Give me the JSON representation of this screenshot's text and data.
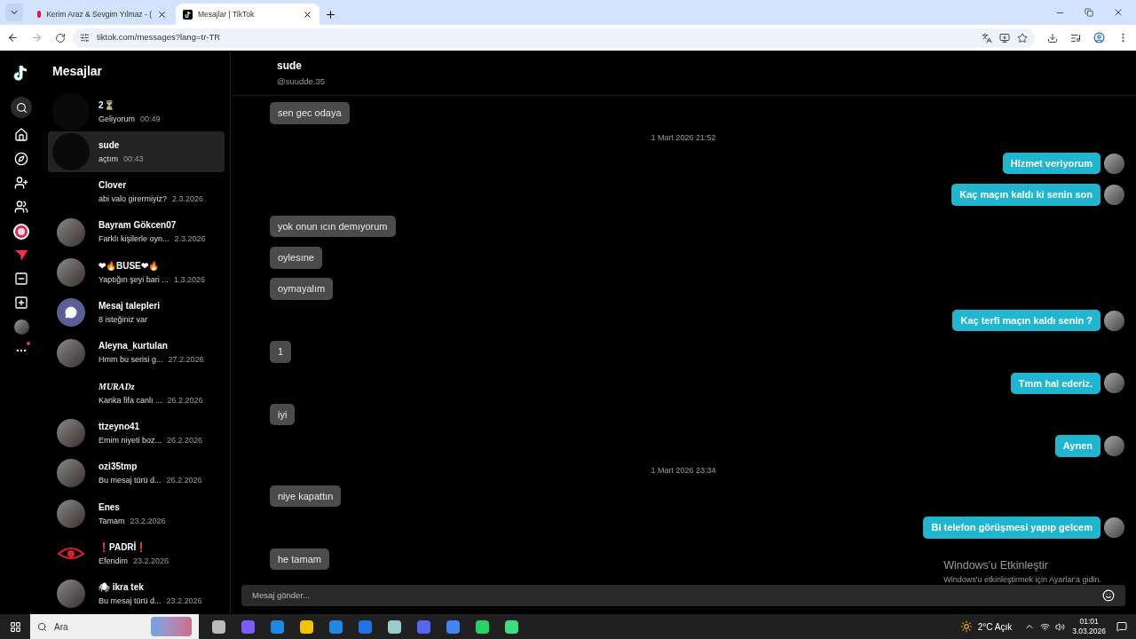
{
  "browser": {
    "tabs": [
      {
        "title": "Kerim Araz & Sevgim Yılmaz - (",
        "selected": false,
        "kind": "video"
      },
      {
        "title": "Mesajlar | TikTok",
        "selected": true,
        "kind": "tiktok"
      }
    ],
    "url": "tiktok.com/messages?lang=tr-TR"
  },
  "inbox": {
    "title": "Mesajlar",
    "conversations": [
      {
        "name": "2⏳",
        "preview": "Geliyorum",
        "time": "00:49",
        "selected": false,
        "avatar": {
          "kind": "blank"
        }
      },
      {
        "name": "sude",
        "preview": "açtım",
        "time": "00:43",
        "selected": true,
        "avatar": {
          "kind": "blank"
        }
      },
      {
        "name": "Clover",
        "preview": "abi valo girermiyiz?",
        "time": "2.3.2026",
        "selected": false
      },
      {
        "name": "Bayram Gökcen07",
        "preview": "Farklı kişilerle oyn...",
        "time": "2.3.2026",
        "selected": false,
        "avatar": {
          "kind": "photo"
        }
      },
      {
        "name": "❤🔥BUSE❤🔥",
        "preview": "Yaptığın şeyi bari ...",
        "time": "1.3.2026",
        "selected": false,
        "avatar": {
          "kind": "photo"
        }
      },
      {
        "name": "Mesaj talepleri",
        "preview": "8 isteğiniz var",
        "selected": false,
        "avatar": {
          "kind": "request"
        }
      },
      {
        "name": "Aleyna_kurtulan",
        "preview": "Hmm bu serisi g...",
        "time": "27.2.2026",
        "selected": false,
        "avatar": {
          "kind": "photo"
        }
      },
      {
        "name": "MURADz",
        "preview": "Kanka fifa canlı ...",
        "time": "26.2.2026",
        "selected": false,
        "fancy": true
      },
      {
        "name": "ttzeyno41",
        "preview": "Emim niyeti boz...",
        "time": "26.2.2026",
        "selected": false,
        "avatar": {
          "kind": "photo"
        }
      },
      {
        "name": "ozi35tmp",
        "preview": "Bu mesaj türü d...",
        "time": "26.2.2026",
        "selected": false,
        "avatar": {
          "kind": "photo"
        }
      },
      {
        "name": "Enes",
        "preview": "Tamam",
        "time": "23.2.2026",
        "selected": false,
        "avatar": {
          "kind": "photo"
        }
      },
      {
        "name": "❗PADRİ❗",
        "preview": "Efendim",
        "time": "23.2.2026",
        "selected": false,
        "avatar": {
          "kind": "eye"
        }
      },
      {
        "name": "🕷 ikra tek",
        "preview": "Bu mesaj türü d...",
        "time": "23.2.2026",
        "selected": false,
        "avatar": {
          "kind": "photo"
        }
      }
    ]
  },
  "chat": {
    "name": "sude",
    "handle": "@suudde.35",
    "messages": [
      {
        "kind": "received",
        "text": "sen gec odaya"
      },
      {
        "kind": "timestamp",
        "text": "1 Mart 2026 21:52"
      },
      {
        "kind": "sent",
        "text": "Hizmet veriyorum"
      },
      {
        "kind": "sent",
        "text": "Kaç maçın kaldı ki senin son"
      },
      {
        "kind": "received",
        "text": "yok onun ıcın demıyorum"
      },
      {
        "kind": "received",
        "text": "oylesıne"
      },
      {
        "kind": "received",
        "text": "oymayalım"
      },
      {
        "kind": "sent",
        "text": "Kaç terfi maçın kaldı senin ?"
      },
      {
        "kind": "received",
        "text": "1"
      },
      {
        "kind": "sent",
        "text": "Tmm hal ederiz."
      },
      {
        "kind": "received",
        "text": "iyi"
      },
      {
        "kind": "sent",
        "text": "Aynen"
      },
      {
        "kind": "timestamp",
        "text": "1 Mart 2026 23:34"
      },
      {
        "kind": "received",
        "text": "niye kapattın"
      },
      {
        "kind": "sent",
        "text": "Bi telefon görüşmesi yapıp gelcem"
      },
      {
        "kind": "received",
        "text": "he tamam"
      }
    ],
    "input": {
      "placeholder": "Mesaj gönder..."
    }
  },
  "activation": {
    "title": "Windows'u Etkinleştir",
    "subtitle": "Windows'u etkinleştirmek için Ayarlar'a gidin."
  },
  "taskbar": {
    "search_placeholder": "Ara",
    "weather": "2°C Açık",
    "time": "01:01",
    "date": "3.03.2026"
  }
}
